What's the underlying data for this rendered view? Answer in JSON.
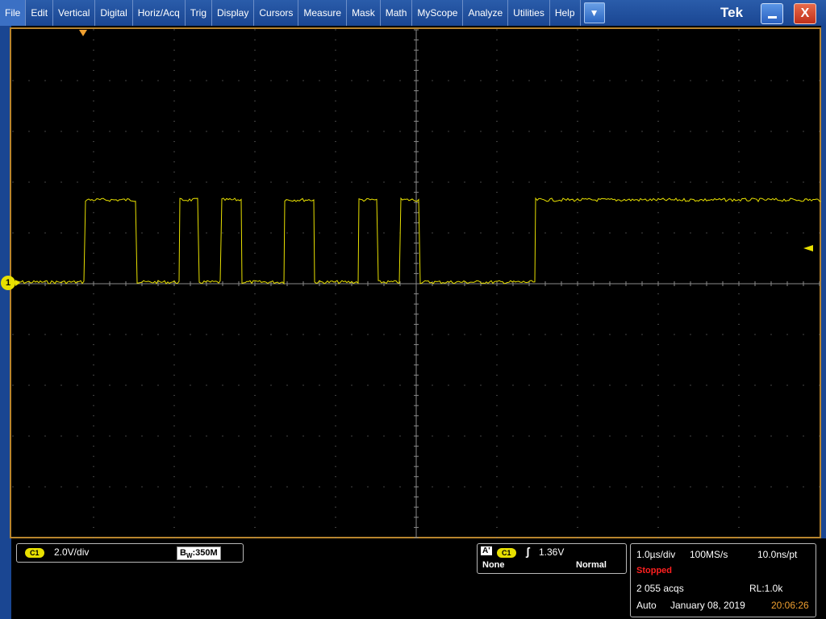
{
  "menu": {
    "items": [
      "File",
      "Edit",
      "Vertical",
      "Digital",
      "Horiz/Acq",
      "Trig",
      "Display",
      "Cursors",
      "Measure",
      "Mask",
      "Math",
      "MyScope",
      "Analyze",
      "Utilities",
      "Help"
    ],
    "dropdown_glyph": "▼",
    "brand": "Tek",
    "close_glyph": "X"
  },
  "channel": {
    "badge": "C1",
    "scale": "2.0V/div",
    "bw_prefix": "B",
    "bw_sub": "W",
    "bw_value": ":350M",
    "marker": "1",
    "color": "#e8e000"
  },
  "trigger": {
    "a_label": "A'",
    "source_badge": "C1",
    "slope_glyph": "ʃ",
    "level": "1.36V",
    "coupling": "None",
    "mode": "Normal"
  },
  "acq": {
    "timebase": "1.0µs/div",
    "sample_rate": "100MS/s",
    "resolution": "10.0ns/pt",
    "status": "Stopped",
    "acqs": "2 055 acqs",
    "record_length": "RL:1.0k",
    "trigger_mode": "Auto",
    "date": "January 08, 2019",
    "time": "20:06:26"
  },
  "colors": {
    "trace": "#e8e000",
    "grid": "#8a8a8a",
    "frame": "#b8852e",
    "status_stopped": "#ff2020",
    "time_orange": "#f0a030"
  }
}
